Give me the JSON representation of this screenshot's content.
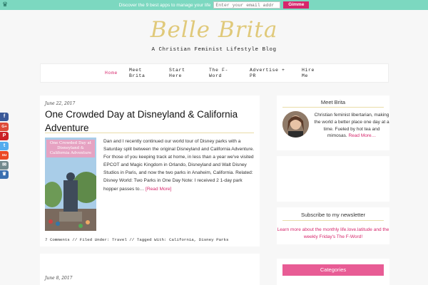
{
  "topbar": {
    "promo_text": "Discover the 9 best apps to manage your life",
    "email_placeholder": "Enter your email addr",
    "button_label": "Gimme",
    "color": "#7cd8c0"
  },
  "header": {
    "logo": "Belle Brita",
    "tagline": "A Christian Feminist Lifestyle Blog"
  },
  "nav": {
    "items": [
      {
        "label": "Home"
      },
      {
        "label": "Meet Brita"
      },
      {
        "label": "Start Here"
      },
      {
        "label": "The F-Word"
      },
      {
        "label": "Advertise + PR"
      },
      {
        "label": "Hire Me"
      }
    ],
    "active_color": "#d6266b"
  },
  "share": {
    "buttons": [
      {
        "icon": "facebook-icon",
        "glyph": "f",
        "color": "#3b5998"
      },
      {
        "icon": "google-plus-icon",
        "glyph": "G+",
        "color": "#dd4b39"
      },
      {
        "icon": "pinterest-icon",
        "glyph": "P",
        "color": "#cb2027"
      },
      {
        "icon": "twitter-icon",
        "glyph": "t",
        "color": "#55acee"
      },
      {
        "icon": "stumbleupon-icon",
        "glyph": "su",
        "color": "#eb4924"
      },
      {
        "icon": "email-icon",
        "glyph": "✉",
        "color": "#738a8d"
      },
      {
        "icon": "crown-share-icon",
        "glyph": "♛",
        "color": "#3a6fb0"
      }
    ]
  },
  "post": {
    "date": "June 22, 2017",
    "title": "One Crowded Day at Disneyland & California Adventure",
    "thumbnail_text": "One Crowded Day at Disneyland & California Adventure",
    "excerpt": "Dan and I recently continued our world tour of Disney parks with a Saturday split between the original Disneyland and California Adventure. For those of you keeping track at home, in less than a year we've visited EPCOT and Magic Kingdom in Orlando, Disneyland and Walt Disney Studios in Paris, and now the two parks in Anaheim, California. Related: Disney World: Two Parks in One Day Note: I received 2 1-day park hopper passes to…",
    "read_more": "[Read More]",
    "meta_comments": "7 Comments",
    "meta_filed_prefix": "Filed Under:",
    "meta_category": "Travel",
    "meta_tagged_prefix": "Tagged With:",
    "meta_tags": [
      "California",
      "Disney Parks"
    ]
  },
  "post2": {
    "date": "June 8, 2017"
  },
  "sidebar": {
    "meet": {
      "title": "Meet Brita",
      "text": "Christian feminist libertarian, making the world a better place one day at a time. Fueled by hot tea and mimosas.",
      "read_more": "Read More…"
    },
    "subscribe": {
      "title": "Subscribe to my newsletter",
      "text": "Learn more about the monthly life.love.latitude and the weekly Friday's The F-Word!"
    },
    "categories": {
      "title": "Categories"
    }
  }
}
